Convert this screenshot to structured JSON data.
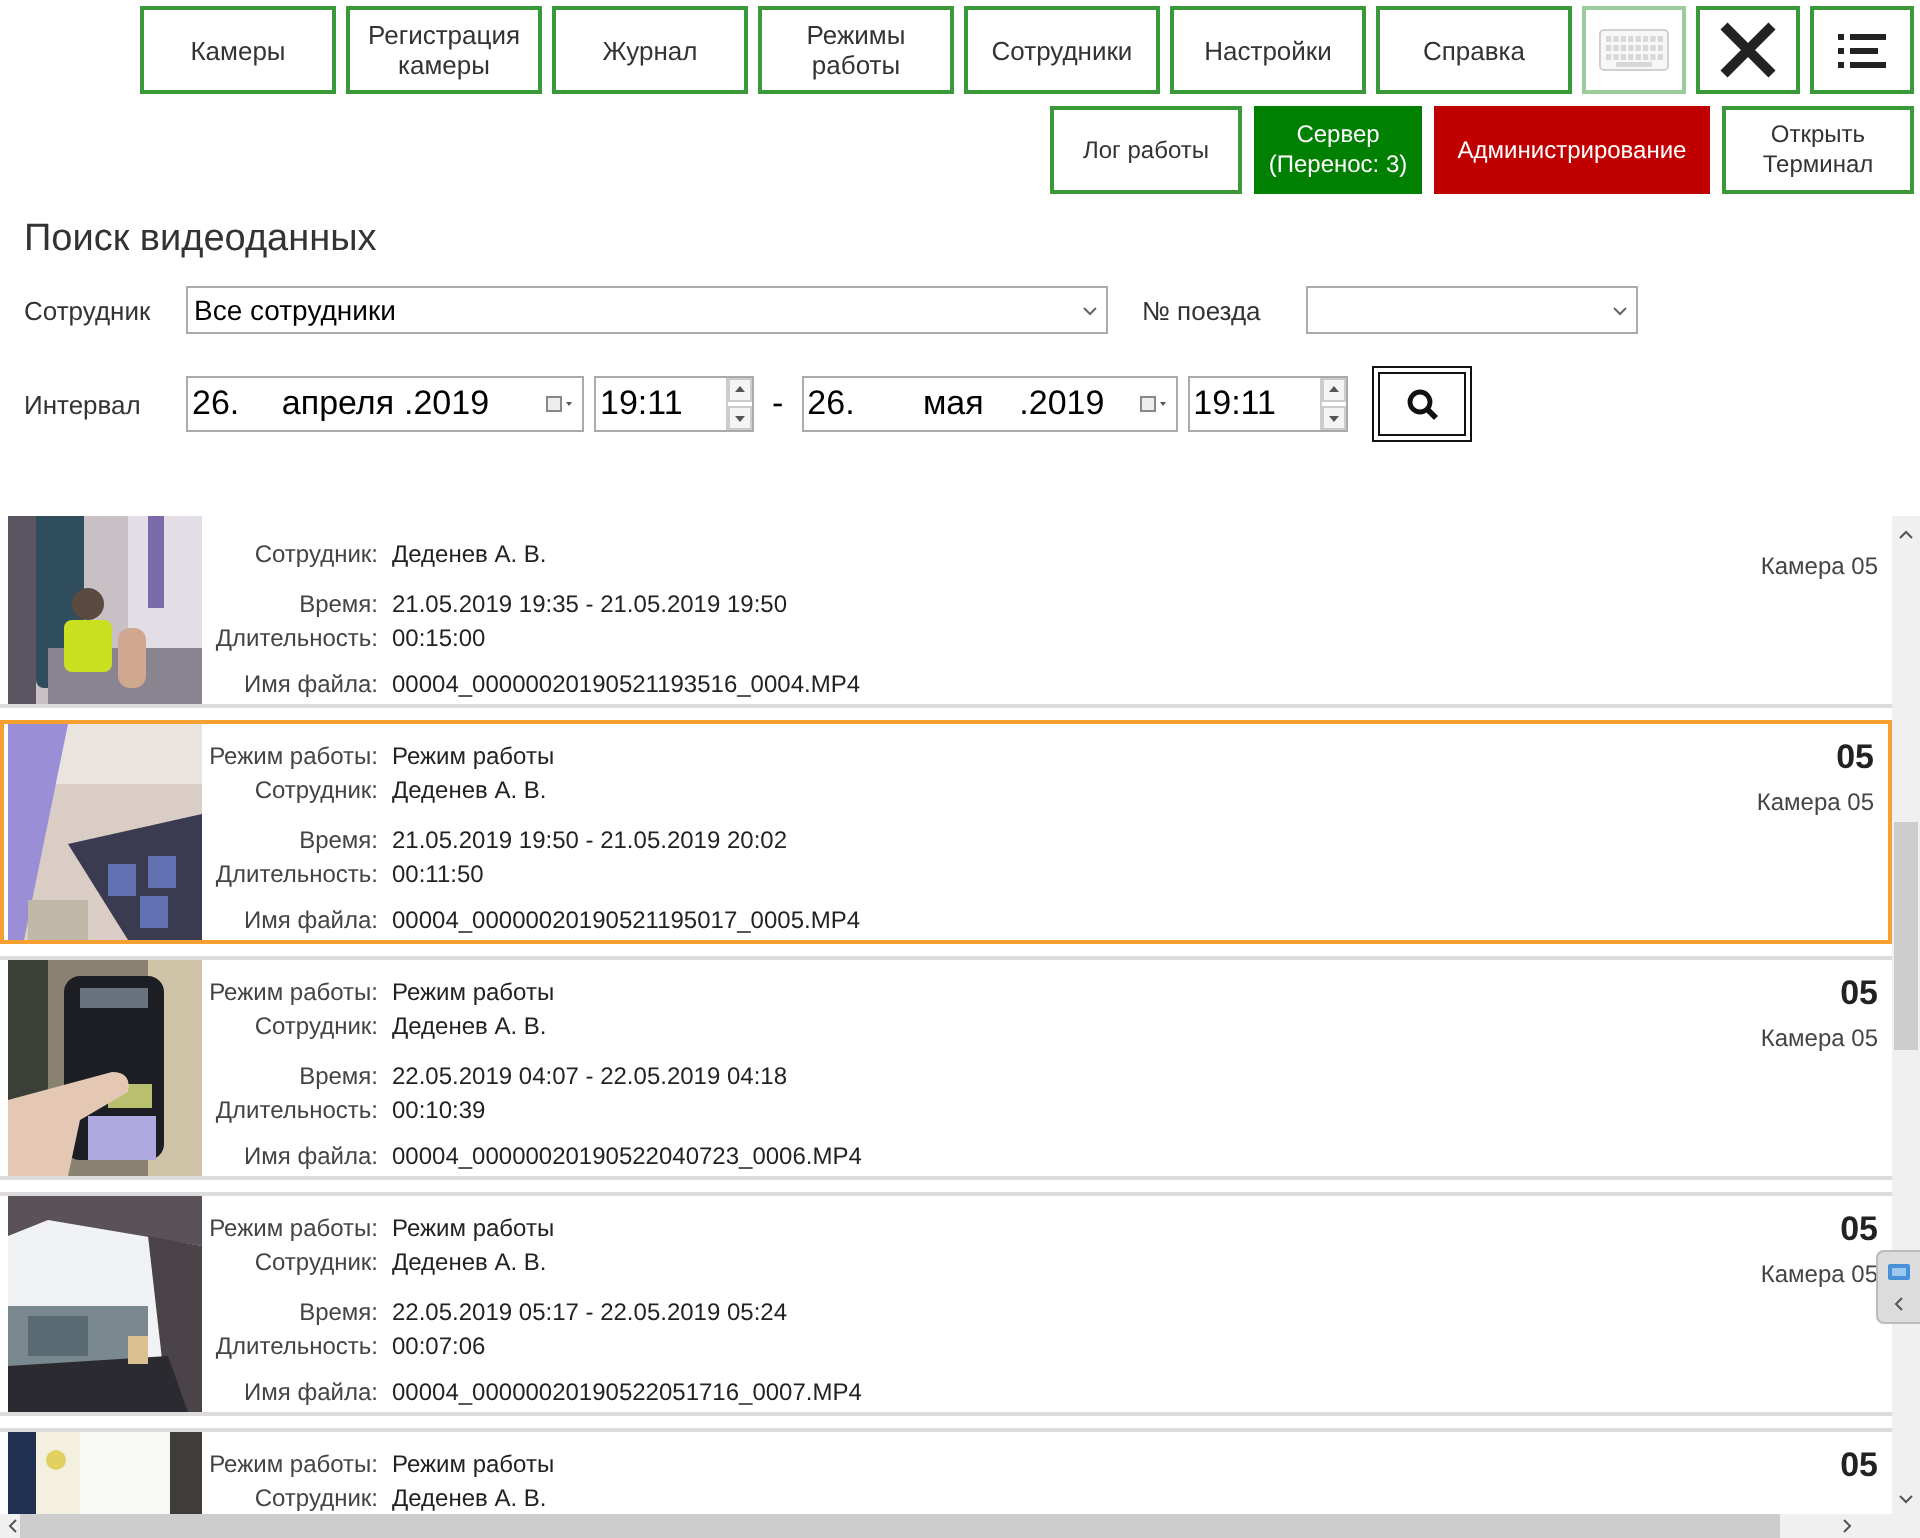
{
  "toolbar": [
    {
      "kind": "text",
      "label": "Камеры",
      "disabled": false
    },
    {
      "kind": "text",
      "label": "Регистрация камеры",
      "disabled": false
    },
    {
      "kind": "text",
      "label": "Журнал",
      "disabled": false
    },
    {
      "kind": "text",
      "label": "Режимы работы",
      "disabled": false
    },
    {
      "kind": "text",
      "label": "Сотрудники",
      "disabled": false
    },
    {
      "kind": "text",
      "label": "Настройки",
      "disabled": false
    },
    {
      "kind": "text",
      "label": "Справка",
      "disabled": false
    },
    {
      "kind": "keyboard",
      "disabled": true
    },
    {
      "kind": "close",
      "disabled": false
    },
    {
      "kind": "menu",
      "disabled": false
    }
  ],
  "actions": [
    {
      "label": "Лог работы"
    },
    {
      "label": "Сервер (Перенос: 3)",
      "color": "#008000"
    },
    {
      "label": "Администрирование",
      "color": "#c00000"
    },
    {
      "label": "Открыть Терминал"
    }
  ],
  "search": {
    "title": "Поиск видеоданных",
    "employee": {
      "label": "Сотрудник",
      "value": "Все сотрудники"
    },
    "train": {
      "label": "№ поезда"
    },
    "interval": {
      "label": "Интервал",
      "separator": "-",
      "from": {
        "day": "26.",
        "month": "апреля",
        "year": ".2019",
        "time": "19:11"
      },
      "to": {
        "day": "26.",
        "month": "мая",
        "year": ".2019",
        "time": "19:11"
      }
    }
  },
  "records": [
    {
      "selected": false,
      "camera": "Камера 05",
      "fields": [
        {
          "kind": "employee",
          "label": "Сотрудник:",
          "value": "Деденев А. В."
        },
        {
          "kind": "time",
          "label": "Время:",
          "value": "21.05.2019 19:35 - 21.05.2019 19:50"
        },
        {
          "kind": "duration",
          "label": "Длительность:",
          "value": "00:15:00"
        },
        {
          "kind": "file",
          "label": "Имя файла:",
          "value": "00004_00000020190521193516_0004.MP4"
        }
      ]
    },
    {
      "selected": true,
      "number": "05",
      "camera": "Камера 05",
      "fields": [
        {
          "kind": "mode",
          "label": "Режим работы:",
          "value": "Режим работы"
        },
        {
          "kind": "employee",
          "label": "Сотрудник:",
          "value": "Деденев А. В."
        },
        {
          "kind": "time",
          "label": "Время:",
          "value": "21.05.2019 19:50 - 21.05.2019 20:02"
        },
        {
          "kind": "duration",
          "label": "Длительность:",
          "value": "00:11:50"
        },
        {
          "kind": "file",
          "label": "Имя файла:",
          "value": "00004_00000020190521195017_0005.MP4"
        }
      ]
    },
    {
      "selected": false,
      "number": "05",
      "camera": "Камера 05",
      "fields": [
        {
          "kind": "mode",
          "label": "Режим работы:",
          "value": "Режим работы"
        },
        {
          "kind": "employee",
          "label": "Сотрудник:",
          "value": "Деденев А. В."
        },
        {
          "kind": "time",
          "label": "Время:",
          "value": "22.05.2019 04:07 - 22.05.2019 04:18"
        },
        {
          "kind": "duration",
          "label": "Длительность:",
          "value": "00:10:39"
        },
        {
          "kind": "file",
          "label": "Имя файла:",
          "value": "00004_00000020190522040723_0006.MP4"
        }
      ]
    },
    {
      "selected": false,
      "number": "05",
      "camera": "Камера 05",
      "fields": [
        {
          "kind": "mode",
          "label": "Режим работы:",
          "value": "Режим работы"
        },
        {
          "kind": "employee",
          "label": "Сотрудник:",
          "value": "Деденев А. В."
        },
        {
          "kind": "time",
          "label": "Время:",
          "value": "22.05.2019 05:17 - 22.05.2019 05:24"
        },
        {
          "kind": "duration",
          "label": "Длительность:",
          "value": "00:07:06"
        },
        {
          "kind": "file",
          "label": "Имя файла:",
          "value": "00004_00000020190522051716_0007.MP4"
        }
      ]
    },
    {
      "selected": false,
      "number": "05",
      "fields": [
        {
          "kind": "mode",
          "label": "Режим работы:",
          "value": "Режим работы"
        },
        {
          "kind": "employee",
          "label": "Сотрудник:",
          "value": "Деденев А. В."
        }
      ]
    }
  ]
}
